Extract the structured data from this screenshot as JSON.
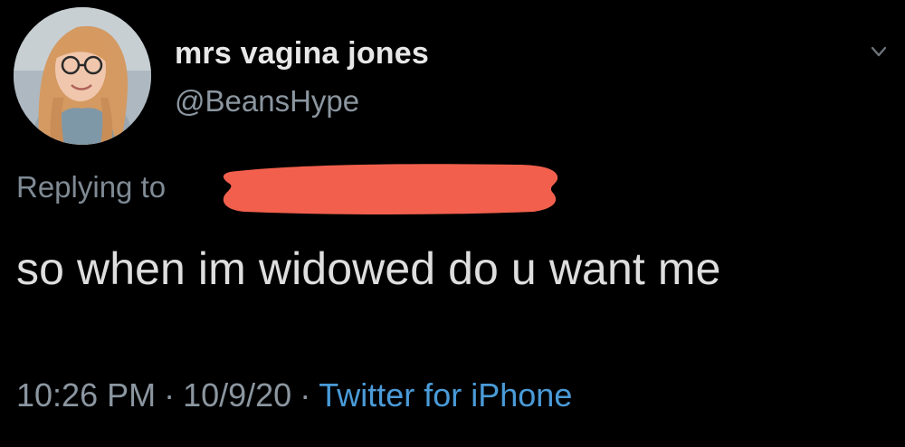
{
  "tweet": {
    "display_name": "mrs vagina jones",
    "handle": "@BeansHype",
    "replying_to_label": "Replying to",
    "text": "so when im widowed do u want me",
    "time": "10:26 PM",
    "separator": "·",
    "date": "10/9/20",
    "source": "Twitter for iPhone"
  },
  "icons": {
    "avatar": "avatar",
    "more": "chevron-down-icon"
  },
  "colors": {
    "background": "#000000",
    "name": "#e8e8e8",
    "secondary_text": "#8b96a0",
    "body_text": "#dedede",
    "link": "#4a9bd8",
    "redaction": "#f2604d"
  }
}
